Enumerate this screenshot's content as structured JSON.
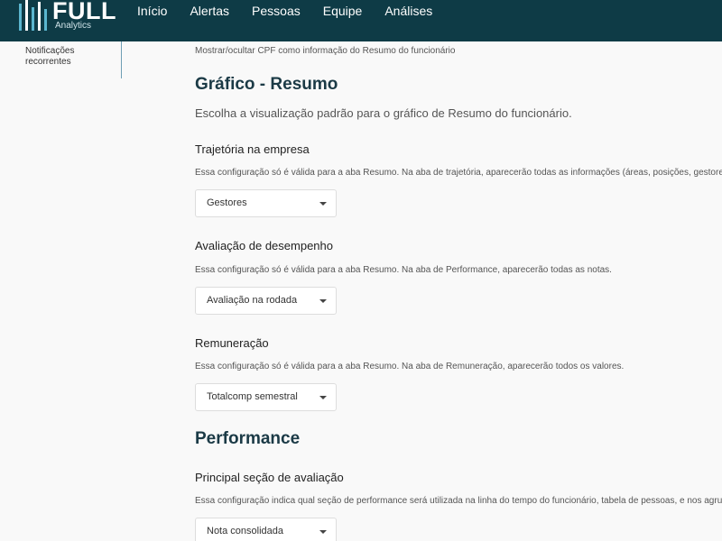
{
  "header": {
    "logo": {
      "name": "FULL",
      "sub": "Analytics"
    },
    "nav": [
      "Início",
      "Alertas",
      "Pessoas",
      "Equipe",
      "Análises"
    ]
  },
  "sidebar": {
    "items": [
      {
        "label": "Notificações recorrentes"
      }
    ]
  },
  "main": {
    "cpf_hint": "Mostrar/ocultar CPF como informação do Resumo do funcionário",
    "grafico": {
      "title": "Gráfico - Resumo",
      "subtitle": "Escolha a visualização padrão para o gráfico de Resumo do funcionário."
    },
    "trajetoria": {
      "label": "Trajetória na empresa",
      "hint": "Essa configuração só é válida para a aba Resumo. Na aba de trajetória, aparecerão todas as informações (áreas, posições, gestores).",
      "value": "Gestores"
    },
    "avaliacao": {
      "label": "Avaliação de desempenho",
      "hint": "Essa configuração só é válida para a aba Resumo. Na aba de Performance, aparecerão todas as notas.",
      "value": "Avaliação na rodada"
    },
    "remuneracao": {
      "label": "Remuneração",
      "hint": "Essa configuração só é válida para a aba Resumo. Na aba de Remuneração, aparecerão todos os valores.",
      "value": "Totalcomp semestral"
    },
    "performance": {
      "title": "Performance"
    },
    "secao": {
      "label": "Principal seção de avaliação",
      "hint": "Essa configuração indica qual seção de performance será utilizada na linha do tempo do funcionário, tabela de pessoas, e nos agrup",
      "value": "Nota consolidada"
    }
  }
}
